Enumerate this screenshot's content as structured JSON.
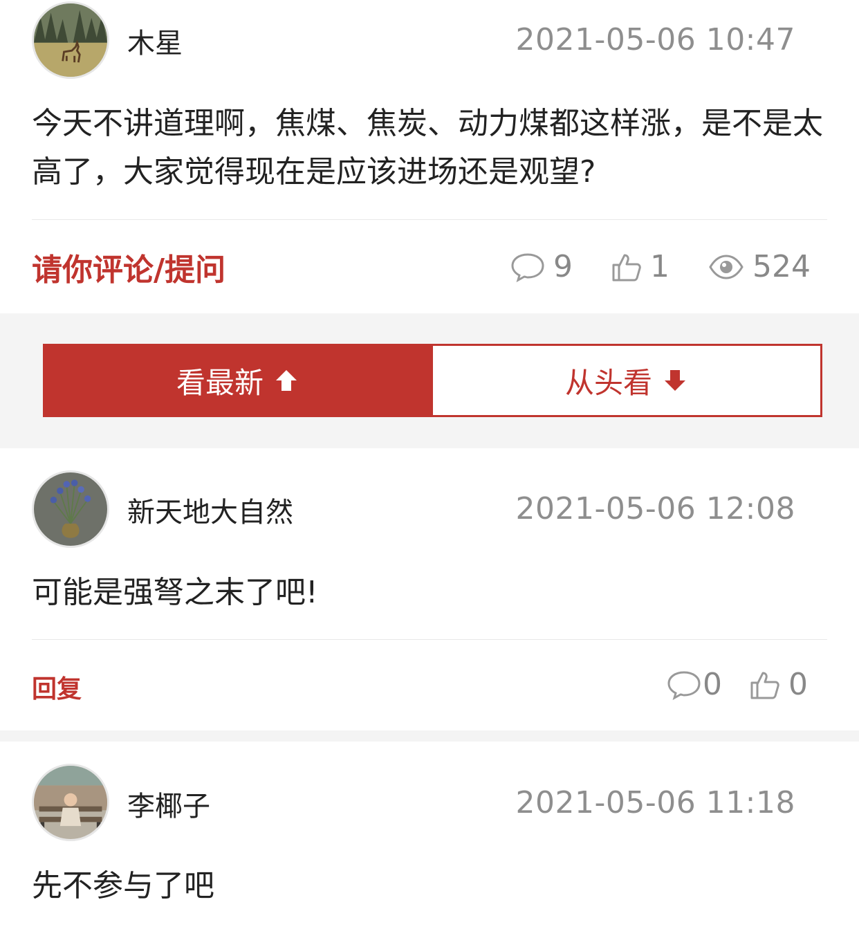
{
  "post": {
    "author": "木星",
    "time": "2021-05-06 10:47",
    "text": "今天不讲道理啊，焦煤、焦炭、动力煤都这样涨，是不是太高了，大家觉得现在是应该进场还是观望?",
    "comment_prompt": "请你评论/提问",
    "stats": {
      "comments": "9",
      "likes": "1",
      "views": "524"
    }
  },
  "sort": {
    "newest_label": "看最新",
    "oldest_label": "从头看"
  },
  "comments": [
    {
      "author": "新天地大自然",
      "time": "2021-05-06 12:08",
      "text": "可能是强弩之末了吧!",
      "reply_label": "回复",
      "reply_count": "0",
      "like_count": "0"
    },
    {
      "author": "李椰子",
      "time": "2021-05-06 11:18",
      "text": "先不参与了吧"
    }
  ],
  "colors": {
    "accent": "#c0342e",
    "muted": "#8e8e8e",
    "band": "#f4f4f4"
  },
  "icons": [
    "comment-bubble-icon",
    "thumbs-up-icon",
    "eye-icon",
    "arrow-up-icon",
    "arrow-down-icon"
  ]
}
